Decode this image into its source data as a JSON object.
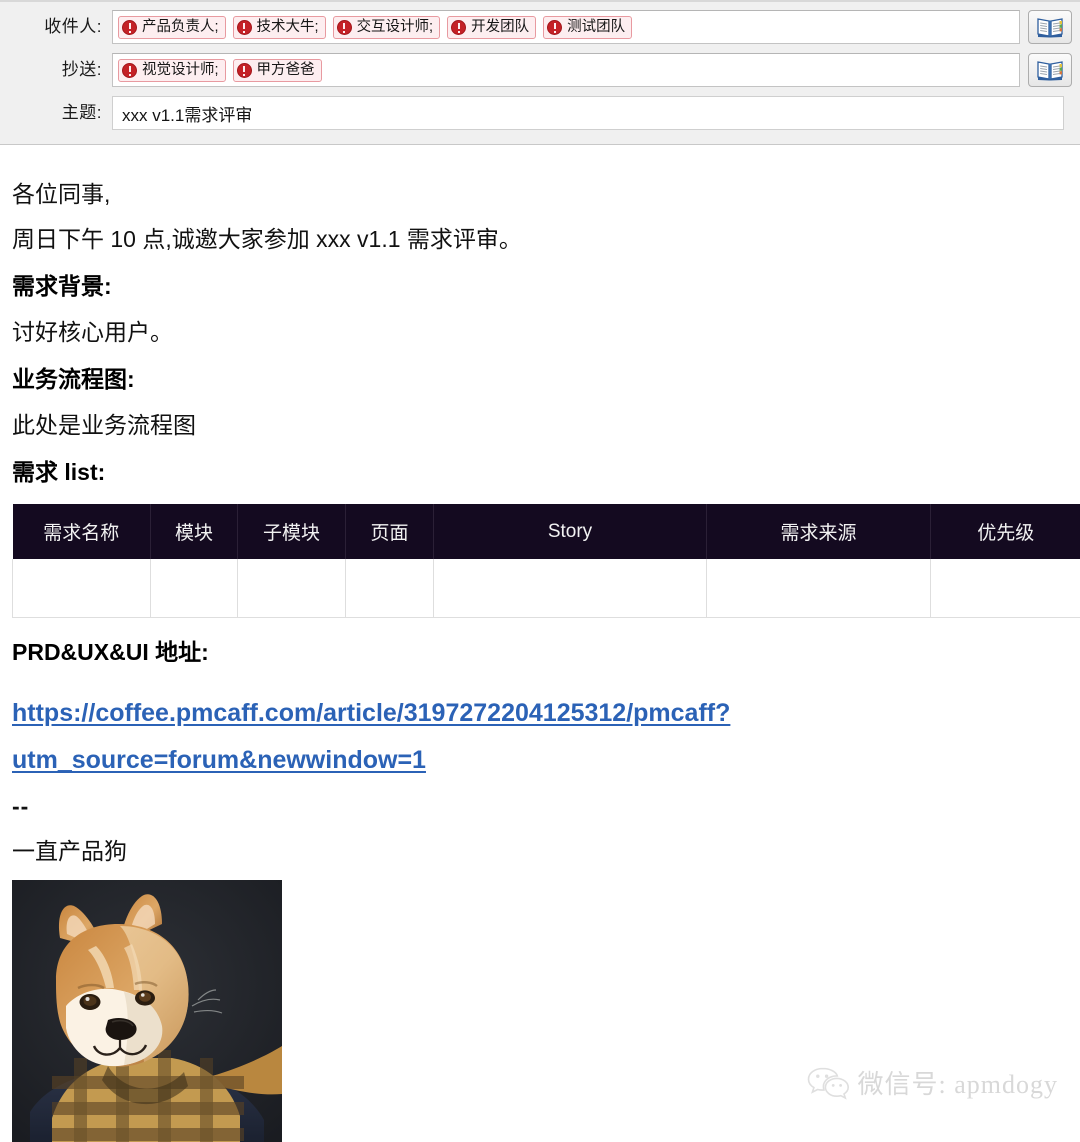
{
  "compose": {
    "to": {
      "label": "收件人:",
      "recipients": [
        {
          "name": "产品负责人;",
          "icon": "error-circle-icon"
        },
        {
          "name": "技术大牛;",
          "icon": "error-circle-icon"
        },
        {
          "name": "交互设计师;",
          "icon": "error-circle-icon"
        },
        {
          "name": "开发团队",
          "icon": "error-circle-icon"
        },
        {
          "name": "测试团队",
          "icon": "error-circle-icon"
        }
      ],
      "addressbook_icon": "address-book-icon"
    },
    "cc": {
      "label": "抄送:",
      "recipients": [
        {
          "name": "视觉设计师;",
          "icon": "error-circle-icon"
        },
        {
          "name": "甲方爸爸",
          "icon": "error-circle-icon"
        }
      ],
      "addressbook_icon": "address-book-icon"
    },
    "subject": {
      "label": "主题:",
      "value": "xxx v1.1需求评审",
      "placeholder": ""
    }
  },
  "body": {
    "greeting": "各位同事,",
    "intro": "周日下午 10 点,诚邀大家参加 xxx v1.1 需求评审。",
    "section_background_heading": "需求背景:",
    "section_background_text": "讨好核心用户。",
    "section_flow_heading": "业务流程图:",
    "section_flow_text": "此处是业务流程图",
    "section_list_heading": "需求 list:",
    "section_prd_heading": "PRD&UX&UI 地址:",
    "link_line_1": "https://coffee.pmcaff.com/article/3197272204125312/pmcaff?",
    "link_line_2": "utm_source=forum&newwindow=1",
    "signature_divider": "--",
    "signature_name": "一直产品狗"
  },
  "table": {
    "headers": [
      "需求名称",
      "模块",
      "子模块",
      "页面",
      "Story",
      "需求来源",
      "优先级"
    ],
    "rows": [
      [
        "",
        "",
        "",
        "",
        "",
        "",
        ""
      ]
    ]
  },
  "watermark": {
    "icon": "wechat-icon",
    "text": "微信号: apmdogy"
  },
  "attachment": {
    "name": "shiba-inu-portrait-image",
    "alt": "柴犬头像"
  },
  "colors": {
    "chip_border": "#e89aa0",
    "chip_bg": "#fdeef0",
    "chip_icon": "#c42126",
    "table_header_bg": "#140a20",
    "link": "#2b62b6",
    "header_panel_bg": "#f0f0f0"
  }
}
